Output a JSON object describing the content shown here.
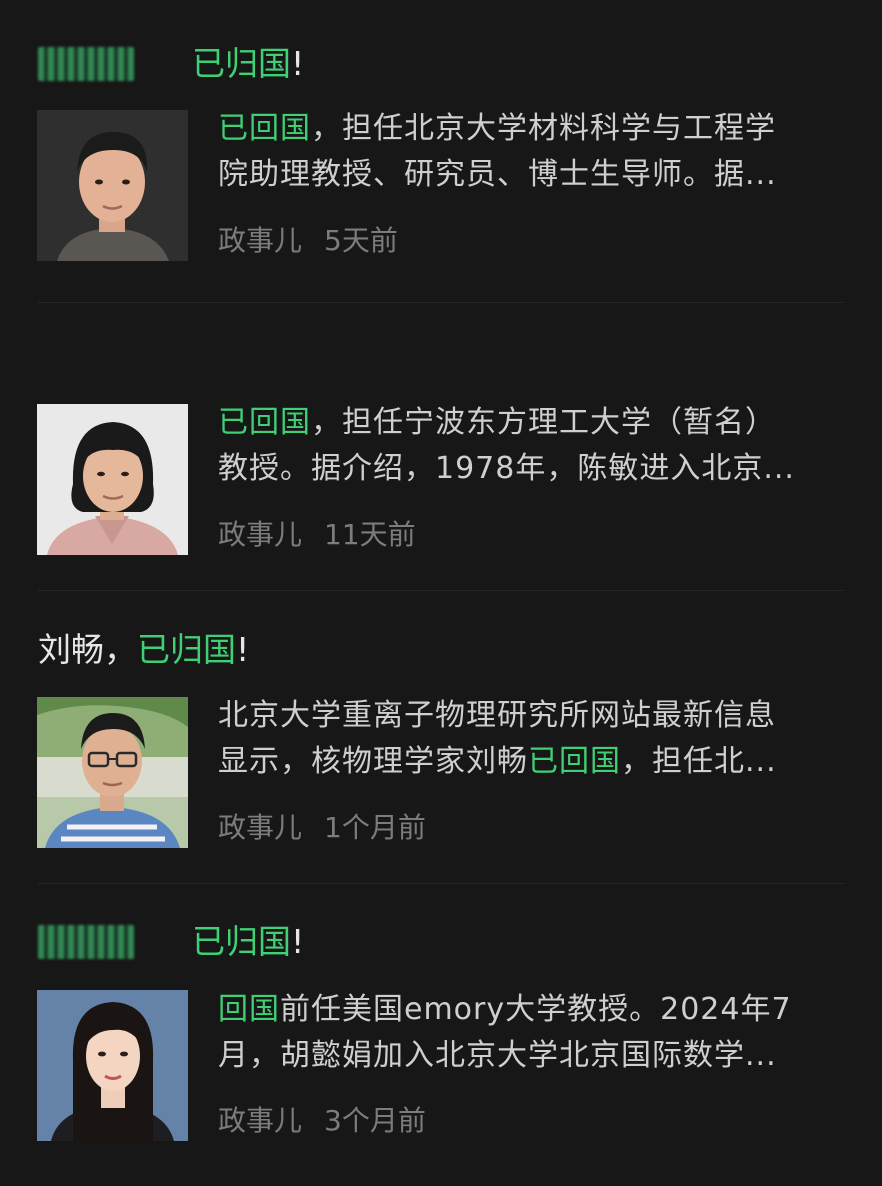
{
  "results": [
    {
      "title_prefix": "",
      "title_highlight": "已归国",
      "title_suffix": "!",
      "has_blurred_name": true,
      "snippet_line1_highlight": "已回国",
      "snippet_line1_rest": "，担任北京大学材料科学与工程学",
      "snippet_line2": "院助理教授、研究员、博士生导师。据...",
      "source": "政事儿",
      "time": "5天前",
      "thumb_icon": "portrait-man-icon"
    },
    {
      "title_prefix": "",
      "title_highlight": "",
      "title_suffix": "",
      "has_blurred_name": false,
      "snippet_line1_highlight": "已回国",
      "snippet_line1_rest": "，担任宁波东方理工大学（暂名）",
      "snippet_line2": "教授。据介绍，1978年，陈敏进入北京...",
      "source": "政事儿",
      "time": "11天前",
      "thumb_icon": "portrait-woman-icon"
    },
    {
      "title_prefix": "刘畅，",
      "title_highlight": "已归国",
      "title_suffix": "!",
      "has_blurred_name": false,
      "snippet_line1_plain": "北京大学重离子物理研究所网站最新信息",
      "snippet_line2_pre": "显示，核物理学家刘畅",
      "snippet_line2_highlight": "已回国",
      "snippet_line2_post": "，担任北...",
      "source": "政事儿",
      "time": "1个月前",
      "thumb_icon": "portrait-man-glasses-icon"
    },
    {
      "title_prefix": "",
      "title_highlight": "已归国",
      "title_suffix": "!",
      "has_blurred_name": true,
      "snippet_line1_highlight": "回国",
      "snippet_line1_rest": "前任美国emory大学教授。2024年7",
      "snippet_line2": "月，胡懿娟加入北京大学北京国际数学...",
      "source": "政事儿",
      "time": "3个月前",
      "thumb_icon": "portrait-woman-longhair-icon"
    }
  ],
  "colors": {
    "background": "#171717",
    "highlight": "#3fcf74",
    "text": "#cfcfcf",
    "meta": "#7c7c7c"
  }
}
